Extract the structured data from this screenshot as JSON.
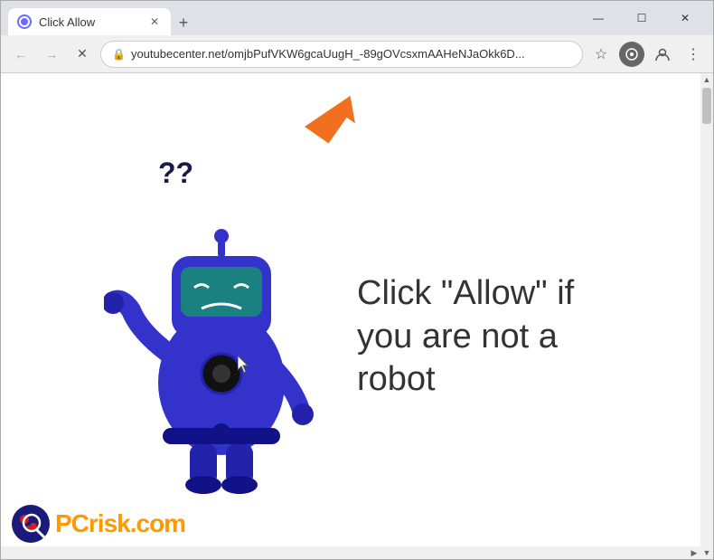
{
  "browser": {
    "tab_title": "Click Allow",
    "tab_favicon": "circle-icon",
    "new_tab_label": "+",
    "window_controls": {
      "minimize": "—",
      "maximize": "☐",
      "close": "✕"
    },
    "nav": {
      "back": "←",
      "forward": "→",
      "reload": "✕"
    },
    "address_bar": {
      "url": "youtubecenter.net/omjbPufVKW6gcaUugH_-89gOVcsxmAAHeNJaOkk6D...",
      "lock_icon": "🔒"
    },
    "toolbar_icons": {
      "star": "☆",
      "extensions": "⬡",
      "profile": "👤",
      "menu": "⋮"
    }
  },
  "page": {
    "question_marks": "??",
    "main_text": "Click \"Allow\" if you are not a robot",
    "arrow_direction": "upper-right"
  },
  "logo": {
    "name": "PC",
    "suffix": "risk.com"
  },
  "scrollbar": {
    "up_arrow": "▲",
    "down_arrow": "▼",
    "right_arrow": "▶"
  }
}
